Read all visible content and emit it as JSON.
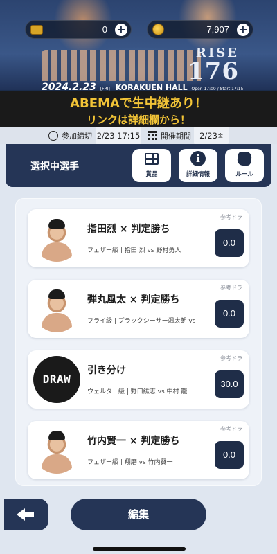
{
  "banner": {
    "event_logo_top": "RISE",
    "event_logo_num": "176",
    "event_date": "2024.2.23",
    "event_day": "[FRI]",
    "venue": "KORAKUEN HALL",
    "times": "Open 17:00 / Start 17:15",
    "promo_line1": "ABEMAで生中継あり！",
    "promo_line2": "リンクは詳細欄から！"
  },
  "wallet": {
    "ticket_amount": "0",
    "coin_amount": "7,907",
    "ticket_icon": "ticket-icon",
    "coin_icon": "coin-icon"
  },
  "infobar": {
    "deadline_label": "参加締切",
    "deadline_value": "2/23 17:15",
    "period_label": "開催期間",
    "period_value": "2/23",
    "period_day": "金"
  },
  "header": {
    "title": "選択中選手",
    "buttons": [
      {
        "label": "賞品",
        "icon": "gift-icon"
      },
      {
        "label": "詳細情報",
        "icon": "info-icon"
      },
      {
        "label": "ルール",
        "icon": "rules-icon"
      }
    ]
  },
  "picks": [
    {
      "name": "指田烈 × 判定勝ち",
      "sub": "フェザー級 | 指田 烈 vs 野村勇人",
      "ref": "参考ドラ",
      "value": "0.0"
    },
    {
      "name": "弾丸風太 × 判定勝ち",
      "sub": "フライ級 | ブラックシーサー颯太朗 vs",
      "ref": "参考ドラ",
      "value": "0.0"
    },
    {
      "name": "引き分け",
      "sub": "ウェルター級 | 野口紘志 vs 中村 龍",
      "ref": "参考ドラ",
      "value": "30.0",
      "avatar_text": "DRAW"
    },
    {
      "name": "竹内賢一 × 判定勝ち",
      "sub": "フェザー級 | 翔磨 vs 竹内賢一",
      "ref": "参考ドラ",
      "value": "0.0"
    }
  ],
  "footer": {
    "edit_label": "編集"
  }
}
